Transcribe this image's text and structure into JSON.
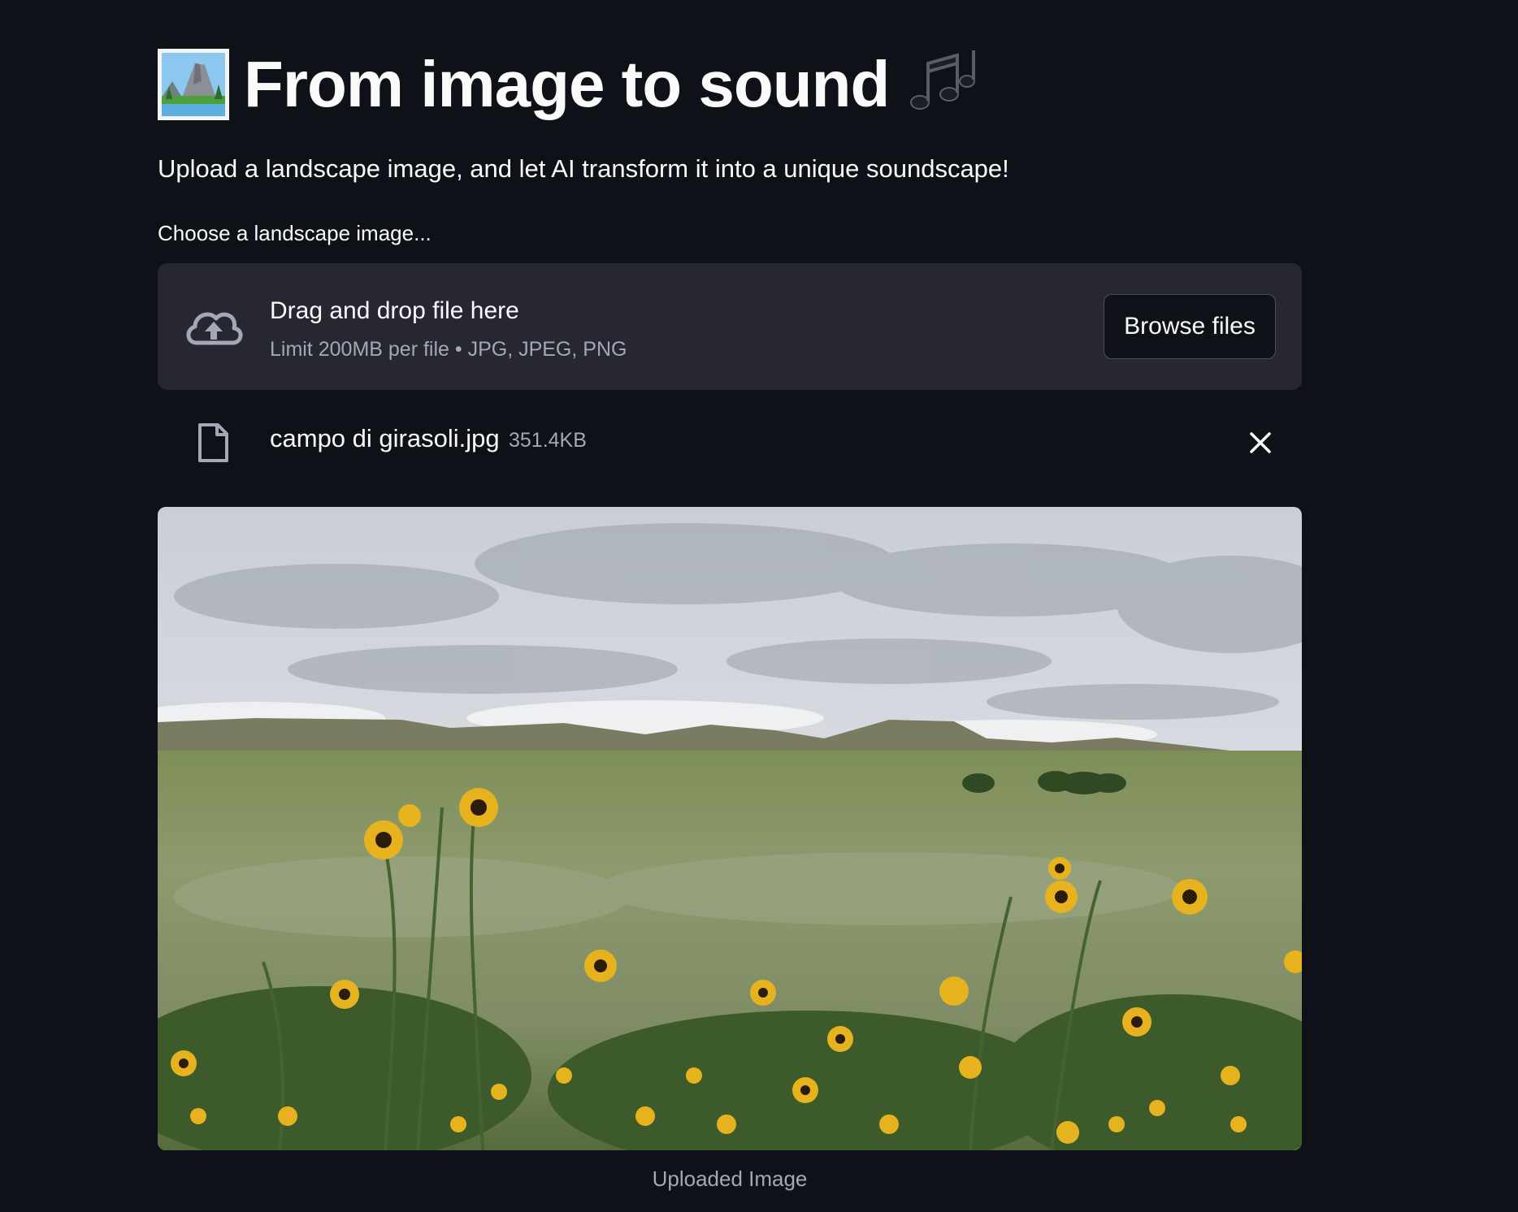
{
  "header": {
    "title": "From image to sound",
    "title_icon": "landscape-photo-icon",
    "notes_icon": "musical-notes-icon"
  },
  "subtitle": "Upload a landscape image, and let AI transform it into a unique soundscape!",
  "uploader": {
    "label": "Choose a landscape image...",
    "drop_title": "Drag and drop file here",
    "drop_hint": "Limit 200MB per file • JPG, JPEG, PNG",
    "browse_label": "Browse files",
    "upload_icon": "cloud-upload-icon"
  },
  "file": {
    "name": "campo di girasoli.jpg",
    "size": "351.4KB",
    "file_icon": "file-icon",
    "remove_icon": "close-icon"
  },
  "image": {
    "caption": "Uploaded Image"
  },
  "colors": {
    "background": "#0e1117",
    "dropzone": "#262730",
    "text": "#fafafa",
    "muted": "#a3a8b8"
  }
}
